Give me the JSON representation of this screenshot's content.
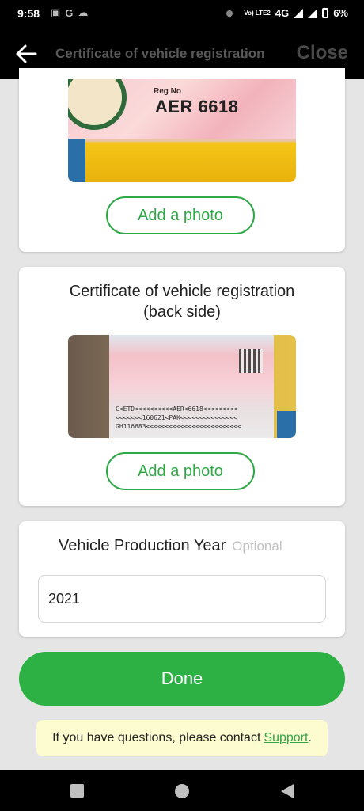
{
  "status_bar": {
    "time": "9:58",
    "left_icons": [
      "video-call-icon",
      "google-icon",
      "cloud-icon"
    ],
    "network": "Vo) LTE2",
    "network_type": "4G",
    "battery": "6%"
  },
  "app_bar": {
    "title": "Certificate of vehicle registration",
    "close_label": "Close"
  },
  "card_front": {
    "photo_regno_label": "Reg No",
    "photo_regno": "AER 6618",
    "add_photo_label": "Add a photo"
  },
  "card_back": {
    "heading_line1": "Certificate of vehicle registration",
    "heading_line2": "(back side)",
    "mrz_lines": "C<ETD<<<<<<<<<<AER<6618<<<<<<<<<\n<<<<<<<160621<PAK<<<<<<<<<<<<<<<\nGH116683<<<<<<<<<<<<<<<<<<<<<<<<<",
    "add_photo_label": "Add a photo"
  },
  "production_year": {
    "label": "Vehicle Production Year",
    "optional_label": "Optional",
    "value": "2021"
  },
  "done_label": "Done",
  "notice": {
    "text": "If you have questions, please contact",
    "link": "Support",
    "suffix": "."
  },
  "colors": {
    "accent": "#2db144",
    "notice_bg": "#fdfbd0"
  }
}
